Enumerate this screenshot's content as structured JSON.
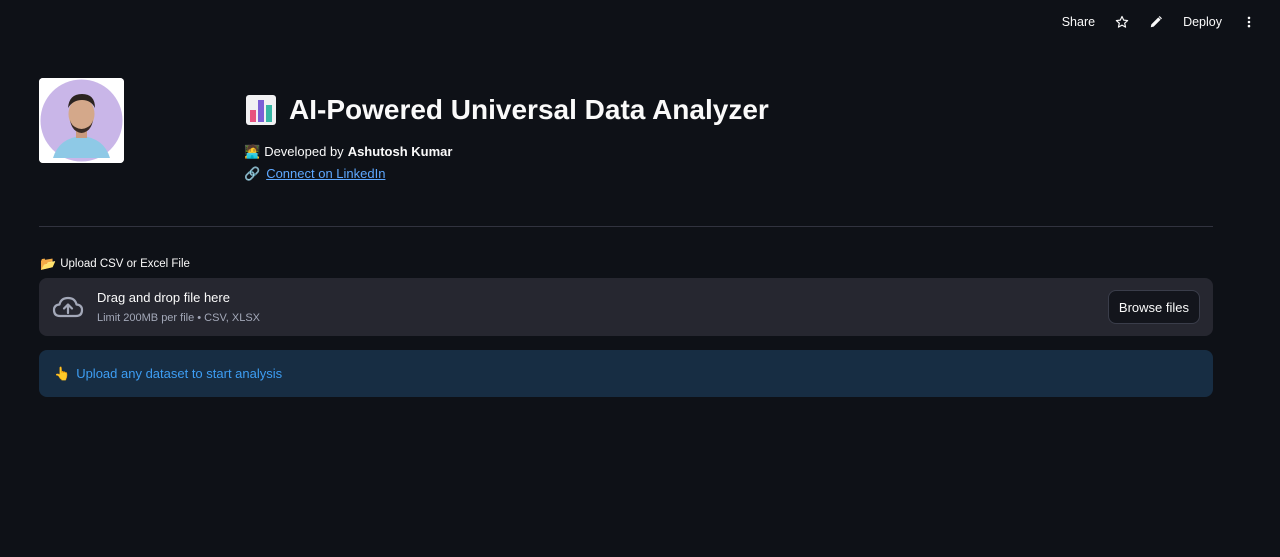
{
  "toolbar": {
    "share_label": "Share",
    "star_icon": "star-icon",
    "edit_icon": "pencil-icon",
    "deploy_label": "Deploy",
    "menu_icon": "vertical-dots-icon"
  },
  "header": {
    "avatar_icon": "profile-photo",
    "title_emoji_icon": "bar-chart-emoji",
    "title": "AI-Powered Universal Data Analyzer",
    "dev_emoji": "🧑‍💻",
    "dev_prefix": "Developed by",
    "dev_name": "Ashutosh Kumar",
    "link_emoji": "🔗",
    "link_label": "Connect on LinkedIn"
  },
  "uploader": {
    "label_emoji": "📂",
    "label": "Upload CSV or Excel File",
    "cloud_icon": "cloud-upload-icon",
    "drop_title": "Drag and drop file here",
    "drop_sub": "Limit 200MB per file • CSV, XLSX",
    "browse_label": "Browse files"
  },
  "info": {
    "emoji": "👆",
    "text": "Upload any dataset to start analysis"
  },
  "colors": {
    "background": "#0e1117",
    "surface": "#262730",
    "info_bg": "#172d43",
    "info_text": "#3d9df3",
    "link": "#5ea8ff"
  }
}
